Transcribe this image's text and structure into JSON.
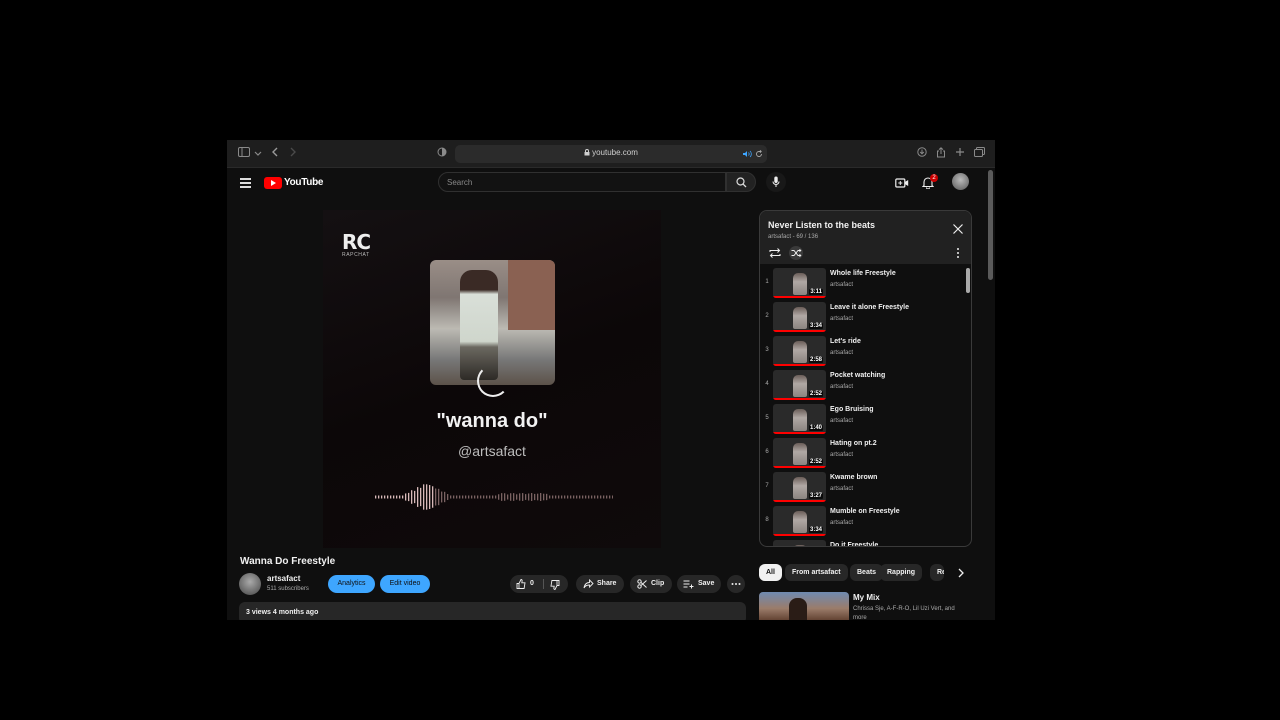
{
  "browser": {
    "url": "youtube.com"
  },
  "header": {
    "logo_text": "YouTube",
    "search_placeholder": "Search",
    "notification_count": "2"
  },
  "player": {
    "brand": "RC",
    "brand_sub": "RAPCHAT",
    "quote": "\"wanna do\"",
    "handle": "@artsafact"
  },
  "video": {
    "title": "Wanna Do Freestyle",
    "channel": "artsafact",
    "subscribers": "511 subscribers",
    "analytics_label": "Analytics",
    "edit_label": "Edit video",
    "like_count": "0",
    "share_label": "Share",
    "clip_label": "Clip",
    "save_label": "Save",
    "description_meta": "3 views  4 months ago"
  },
  "playlist": {
    "title": "Never Listen to the beats",
    "meta": "artsafact - 69 / 136",
    "items": [
      {
        "index": "1",
        "title": "Whole life Freestyle",
        "channel": "artsafact",
        "duration": "3:11",
        "watched": 1.0
      },
      {
        "index": "2",
        "title": "Leave it alone Freestyle",
        "channel": "artsafact",
        "duration": "3:34",
        "watched": 1.0
      },
      {
        "index": "3",
        "title": "Let's ride",
        "channel": "artsafact",
        "duration": "2:58",
        "watched": 1.0
      },
      {
        "index": "4",
        "title": "Pocket watching",
        "channel": "artsafact",
        "duration": "2:52",
        "watched": 1.0
      },
      {
        "index": "5",
        "title": "Ego Bruising",
        "channel": "artsafact",
        "duration": "1:40",
        "watched": 1.0
      },
      {
        "index": "6",
        "title": "Hating on pt.2",
        "channel": "artsafact",
        "duration": "2:52",
        "watched": 1.0
      },
      {
        "index": "7",
        "title": "Kwame brown",
        "channel": "artsafact",
        "duration": "3:27",
        "watched": 1.0
      },
      {
        "index": "8",
        "title": "Mumble on Freestyle",
        "channel": "artsafact",
        "duration": "3:34",
        "watched": 1.0
      },
      {
        "index": "",
        "title": "Do it Freestyle",
        "channel": "",
        "duration": "",
        "watched": 0.0
      }
    ]
  },
  "chips": [
    "All",
    "From artsafact",
    "Beats",
    "Rapping",
    "Re"
  ],
  "recommendation": {
    "title": "My Mix",
    "subtitle": "Chrissa Sje, A-F-R-O, Lil Uzi Vert, and more"
  },
  "colors": {
    "accent_blue": "#3ea6ff",
    "youtube_red": "#ff0000",
    "background": "#0f0f0f"
  }
}
